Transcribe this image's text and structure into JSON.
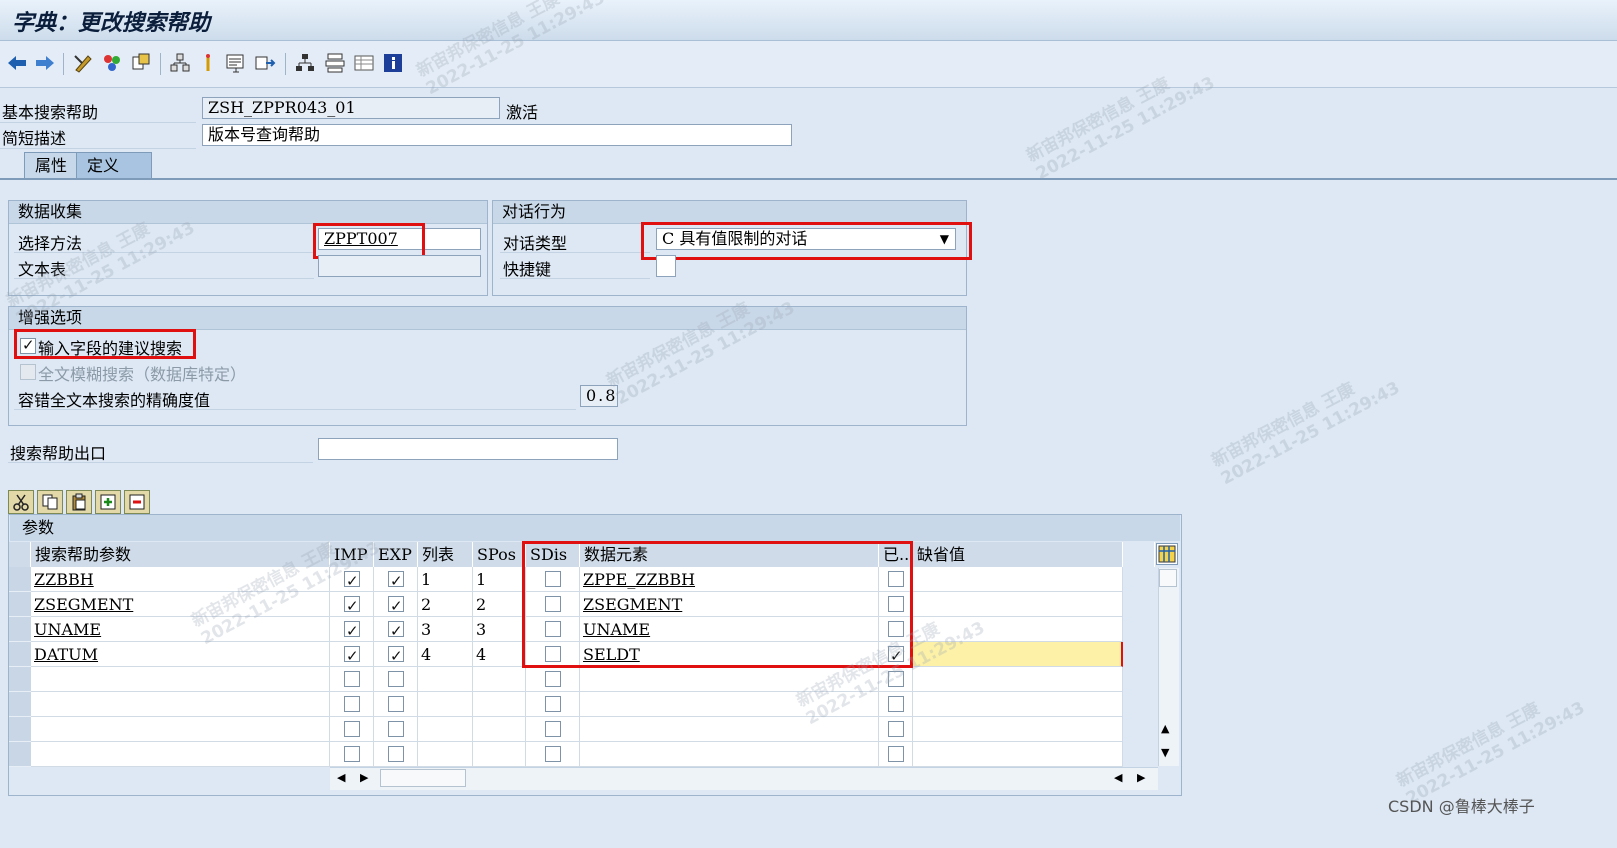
{
  "window": {
    "title": "字典：更改搜索帮助"
  },
  "header": {
    "basic_help_label": "基本搜索帮助",
    "basic_help_value": "ZSH_ZPPR043_01",
    "status": "激活",
    "short_desc_label": "简短描述",
    "short_desc_value": "版本号查询帮助"
  },
  "tabs": [
    {
      "label": "属性",
      "active": false
    },
    {
      "label": "定义",
      "active": true
    }
  ],
  "data_collection": {
    "title": "数据收集",
    "selection_method_label": "选择方法",
    "selection_method_value": "ZPPT007",
    "text_table_label": "文本表",
    "text_table_value": ""
  },
  "dialog": {
    "title": "对话行为",
    "type_label": "对话类型",
    "type_value": "C 具有值限制的对话",
    "hotkey_label": "快捷键",
    "hotkey_value": ""
  },
  "enhanced": {
    "title": "增强选项",
    "proposal_label": "输入字段的建议搜索",
    "proposal_checked": true,
    "fuzzy_label": "全文模糊搜索（数据库特定）",
    "fuzzy_checked": false,
    "accuracy_label": "容错全文本搜索的精确度值",
    "accuracy_value": "0.8"
  },
  "exit": {
    "label": "搜索帮助出口",
    "value": ""
  },
  "params": {
    "title": "参数",
    "columns": [
      "搜索帮助参数",
      "IMP",
      "EXP",
      "列表",
      "SPos",
      "SDis",
      "数据元素",
      "已...",
      "缺省值"
    ],
    "rows": [
      {
        "param": "ZZBBH",
        "imp": true,
        "exp": true,
        "lpos": "1",
        "spos": "1",
        "sdis": false,
        "elem": "ZPPE_ZZBBH",
        "mod": false,
        "default": ""
      },
      {
        "param": "ZSEGMENT",
        "imp": true,
        "exp": true,
        "lpos": "2",
        "spos": "2",
        "sdis": false,
        "elem": "ZSEGMENT",
        "mod": false,
        "default": ""
      },
      {
        "param": "UNAME",
        "imp": true,
        "exp": true,
        "lpos": "3",
        "spos": "3",
        "sdis": false,
        "elem": "UNAME",
        "mod": false,
        "default": ""
      },
      {
        "param": "DATUM",
        "imp": true,
        "exp": true,
        "lpos": "4",
        "spos": "4",
        "sdis": false,
        "elem": "SELDT",
        "mod": true,
        "default": ""
      },
      {
        "param": "",
        "imp": false,
        "exp": false,
        "lpos": "",
        "spos": "",
        "sdis": false,
        "elem": "",
        "mod": false,
        "default": ""
      },
      {
        "param": "",
        "imp": false,
        "exp": false,
        "lpos": "",
        "spos": "",
        "sdis": false,
        "elem": "",
        "mod": false,
        "default": ""
      },
      {
        "param": "",
        "imp": false,
        "exp": false,
        "lpos": "",
        "spos": "",
        "sdis": false,
        "elem": "",
        "mod": false,
        "default": ""
      },
      {
        "param": "",
        "imp": false,
        "exp": false,
        "lpos": "",
        "spos": "",
        "sdis": false,
        "elem": "",
        "mod": false,
        "default": ""
      }
    ]
  },
  "watermark": {
    "line1": "新宙邦保密信息 王康",
    "line2": "2022-11-25 11:29:43"
  },
  "credit": "CSDN @鲁棒大棒子"
}
